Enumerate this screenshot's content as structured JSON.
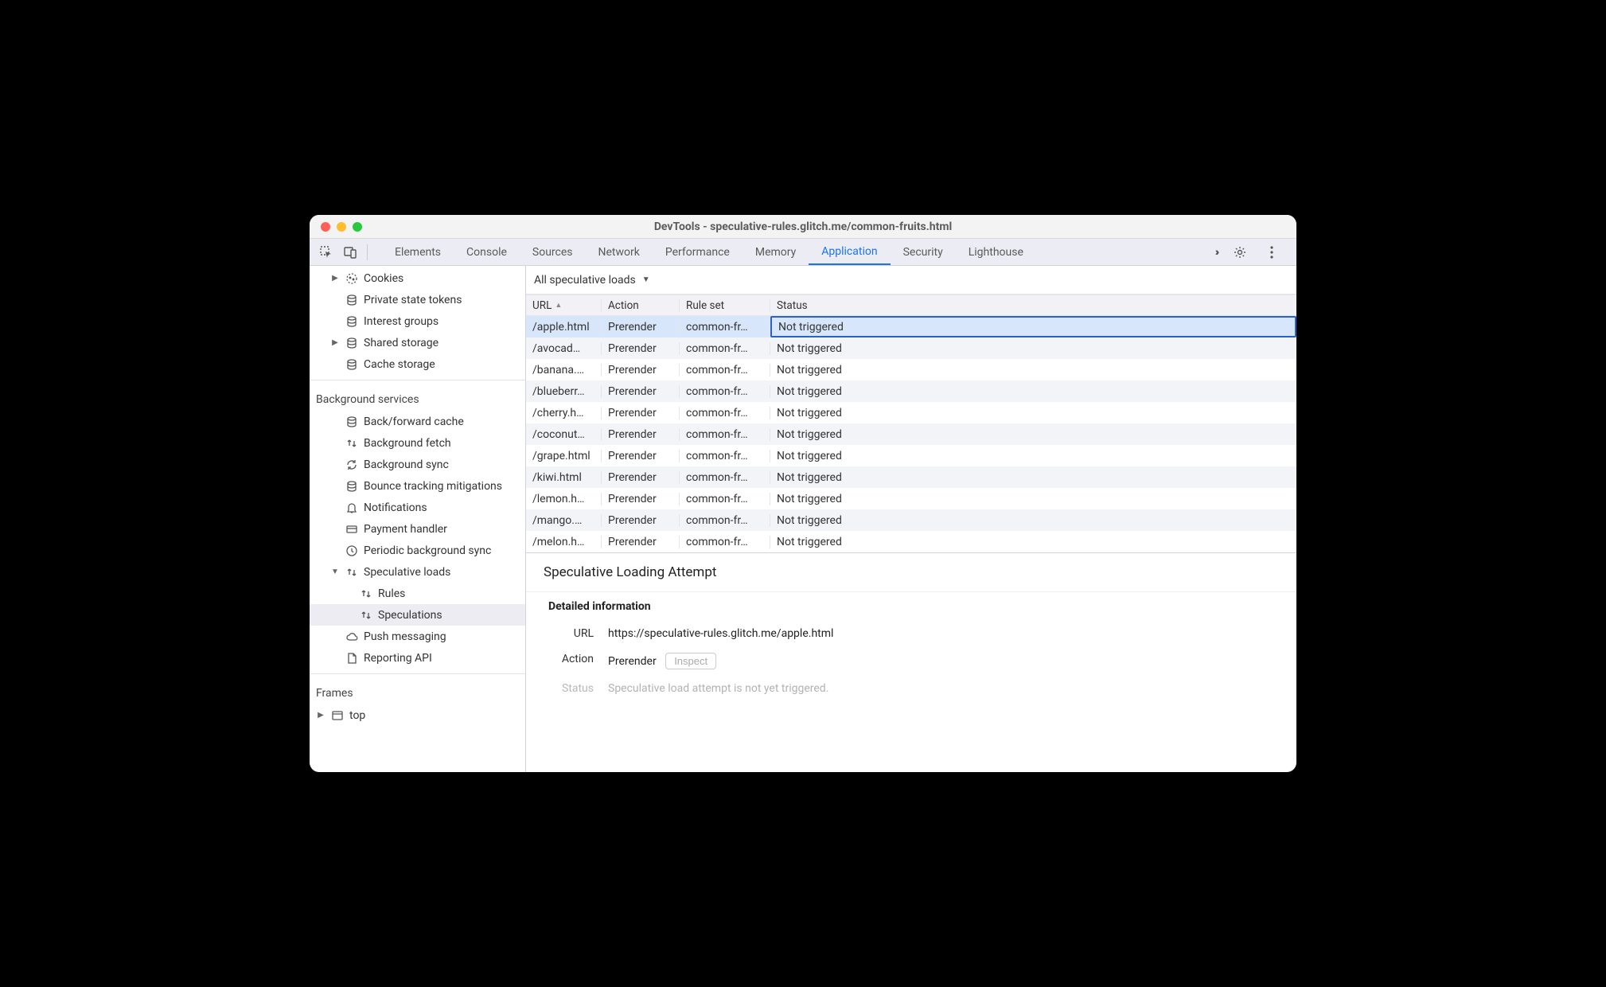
{
  "window": {
    "title": "DevTools - speculative-rules.glitch.me/common-fruits.html"
  },
  "tabs": {
    "items": [
      "Elements",
      "Console",
      "Sources",
      "Network",
      "Performance",
      "Memory",
      "Application",
      "Security",
      "Lighthouse"
    ],
    "active": "Application",
    "overflow": "››"
  },
  "sidebar": {
    "storage": [
      {
        "label": "Cookies",
        "icon": "cookie",
        "expandable": true
      },
      {
        "label": "Private state tokens",
        "icon": "db"
      },
      {
        "label": "Interest groups",
        "icon": "db"
      },
      {
        "label": "Shared storage",
        "icon": "db",
        "expandable": true
      },
      {
        "label": "Cache storage",
        "icon": "db"
      }
    ],
    "bg_head": "Background services",
    "bg": [
      {
        "label": "Back/forward cache",
        "icon": "db"
      },
      {
        "label": "Background fetch",
        "icon": "updown"
      },
      {
        "label": "Background sync",
        "icon": "sync"
      },
      {
        "label": "Bounce tracking mitigations",
        "icon": "db"
      },
      {
        "label": "Notifications",
        "icon": "bell"
      },
      {
        "label": "Payment handler",
        "icon": "card"
      },
      {
        "label": "Periodic background sync",
        "icon": "clock"
      },
      {
        "label": "Speculative loads",
        "icon": "updown",
        "expandable": true,
        "expanded": true
      },
      {
        "label": "Rules",
        "icon": "updown",
        "child": true
      },
      {
        "label": "Speculations",
        "icon": "updown",
        "child": true,
        "selected": true
      },
      {
        "label": "Push messaging",
        "icon": "cloud"
      },
      {
        "label": "Reporting API",
        "icon": "page"
      }
    ],
    "frames_head": "Frames",
    "frames": [
      {
        "label": "top",
        "icon": "frame",
        "expandable": true
      }
    ]
  },
  "filter": {
    "label": "All speculative loads"
  },
  "table": {
    "columns": [
      "URL",
      "Action",
      "Rule set",
      "Status"
    ],
    "sort_col": "URL",
    "rows": [
      {
        "url": "/apple.html",
        "action": "Prerender",
        "ruleset": "common-fr…",
        "status": "Not triggered",
        "selected": true
      },
      {
        "url": "/avocad…",
        "action": "Prerender",
        "ruleset": "common-fr…",
        "status": "Not triggered"
      },
      {
        "url": "/banana.…",
        "action": "Prerender",
        "ruleset": "common-fr…",
        "status": "Not triggered"
      },
      {
        "url": "/blueberr…",
        "action": "Prerender",
        "ruleset": "common-fr…",
        "status": "Not triggered"
      },
      {
        "url": "/cherry.h…",
        "action": "Prerender",
        "ruleset": "common-fr…",
        "status": "Not triggered"
      },
      {
        "url": "/coconut…",
        "action": "Prerender",
        "ruleset": "common-fr…",
        "status": "Not triggered"
      },
      {
        "url": "/grape.html",
        "action": "Prerender",
        "ruleset": "common-fr…",
        "status": "Not triggered"
      },
      {
        "url": "/kiwi.html",
        "action": "Prerender",
        "ruleset": "common-fr…",
        "status": "Not triggered"
      },
      {
        "url": "/lemon.h…",
        "action": "Prerender",
        "ruleset": "common-fr…",
        "status": "Not triggered"
      },
      {
        "url": "/mango.…",
        "action": "Prerender",
        "ruleset": "common-fr…",
        "status": "Not triggered"
      },
      {
        "url": "/melon.h…",
        "action": "Prerender",
        "ruleset": "common-fr…",
        "status": "Not triggered"
      }
    ]
  },
  "details": {
    "title": "Speculative Loading Attempt",
    "section": "Detailed information",
    "url_k": "URL",
    "url_v": "https://speculative-rules.glitch.me/apple.html",
    "action_k": "Action",
    "action_v": "Prerender",
    "inspect": "Inspect",
    "status_k": "Status",
    "status_v": "Speculative load attempt is not yet triggered."
  }
}
